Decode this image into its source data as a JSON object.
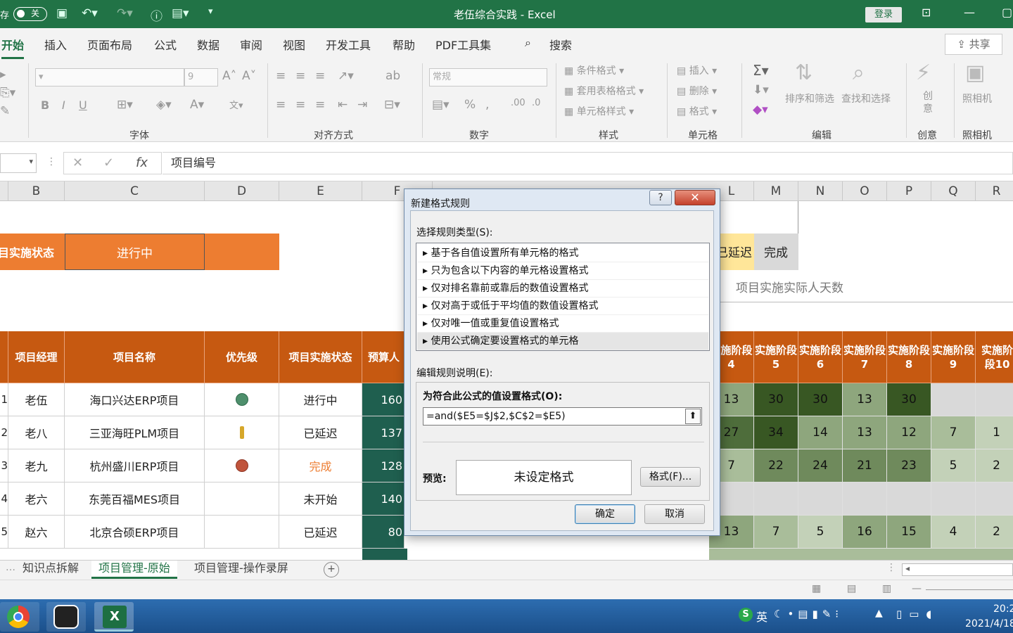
{
  "titlebar": {
    "autosave_label": "存",
    "toggle_label": "关",
    "title": "老伍综合实践 - Excel",
    "login": "登录"
  },
  "menu": {
    "items": [
      "开始",
      "插入",
      "页面布局",
      "公式",
      "数据",
      "审阅",
      "视图",
      "开发工具",
      "帮助",
      "PDF工具集"
    ],
    "search": "搜索",
    "share": "共享"
  },
  "ribbon": {
    "font_size": "9",
    "bold": "B",
    "italic": "I",
    "underline": "U",
    "number_format": "常规",
    "conditional_format": "条件格式",
    "table_format": "套用表格格式",
    "cell_style": "单元格样式",
    "insert": "插入",
    "delete": "删除",
    "format": "格式",
    "sort_filter": "排序和筛选",
    "find_select": "查找和选择",
    "creative": "创意",
    "camera": "照相机",
    "groups": {
      "font": "字体",
      "align": "对齐方式",
      "number": "数字",
      "style": "样式",
      "cells": "单元格",
      "edit": "编辑",
      "creative": "创意",
      "camera": "照相机"
    }
  },
  "formula_bar": {
    "fx": "fx",
    "content": "项目编号"
  },
  "columns": [
    "B",
    "C",
    "D",
    "E",
    "F",
    "L",
    "M",
    "N",
    "O",
    "P",
    "Q",
    "R"
  ],
  "sheet": {
    "status_label": "目实施状态",
    "status_value": "进行中",
    "legend_delay": "已延迟",
    "legend_done": "完成",
    "actual_days_label": "项目实施实际人天数",
    "headers": {
      "pm": "项目经理",
      "name": "项目名称",
      "priority": "优先级",
      "state": "项目实施状态",
      "budget": "预算人",
      "stages": [
        "实施阶段4",
        "实施阶段5",
        "实施阶段6",
        "实施阶段7",
        "实施阶段8",
        "实施阶段9",
        "实施阶段10"
      ]
    },
    "rows": [
      {
        "idx": "1",
        "pm": "老伍",
        "name": "海口兴达ERP项目",
        "state": "进行中",
        "budget": "160",
        "stages": [
          "13",
          "30",
          "30",
          "13",
          "30",
          "",
          ""
        ]
      },
      {
        "idx": "2",
        "pm": "老八",
        "name": "三亚海旺PLM项目",
        "state": "已延迟",
        "budget": "137",
        "stages": [
          "27",
          "34",
          "14",
          "13",
          "12",
          "7",
          "1"
        ]
      },
      {
        "idx": "3",
        "pm": "老九",
        "name": "杭州盛川ERP项目",
        "state": "完成",
        "budget": "128",
        "stages": [
          "7",
          "22",
          "24",
          "21",
          "23",
          "5",
          "2"
        ]
      },
      {
        "idx": "4",
        "pm": "老六",
        "name": "东莞百福MES项目",
        "state": "未开始",
        "budget": "140",
        "stages": [
          "",
          "",
          "",
          "",
          "",
          "",
          ""
        ]
      },
      {
        "idx": "5",
        "pm": "赵六",
        "name": "北京合硕ERP项目",
        "state": "已延迟",
        "budget": "80",
        "stages": [
          "13",
          "7",
          "5",
          "16",
          "15",
          "4",
          "2"
        ]
      }
    ]
  },
  "tabs": [
    "知识点拆解",
    "项目管理-原始",
    "项目管理-操作录屏"
  ],
  "dialog": {
    "title": "新建格式规则",
    "help": "?",
    "close": "✕",
    "rule_type_label": "选择规则类型(S):",
    "rule_types": [
      "基于各自值设置所有单元格的格式",
      "只为包含以下内容的单元格设置格式",
      "仅对排名靠前或靠后的数值设置格式",
      "仅对高于或低于平均值的数值设置格式",
      "仅对唯一值或重复值设置格式",
      "使用公式确定要设置格式的单元格"
    ],
    "edit_label": "编辑规则说明(E):",
    "formula_label": "为符合此公式的值设置格式(O):",
    "formula": "=and($E5=$J$2,$C$2=$E5)",
    "preview_label": "预览:",
    "preview_text": "未设定格式",
    "format_button": "格式(F)...",
    "ok": "确定",
    "cancel": "取消"
  },
  "taskbar": {
    "ime": "英",
    "time": "20:2",
    "date": "2021/4/18"
  }
}
